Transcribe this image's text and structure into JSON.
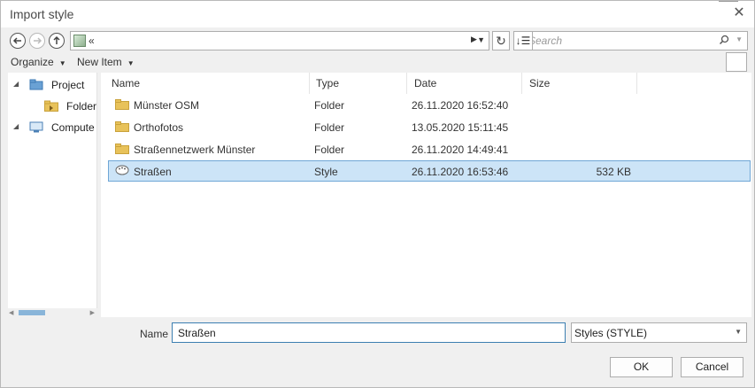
{
  "window": {
    "title": "Import style"
  },
  "nav": {
    "address_text": "«",
    "search_placeholder": "Search"
  },
  "toolbar": {
    "organize_label": "Organize",
    "new_item_label": "New Item"
  },
  "tree": {
    "items": [
      {
        "label": "Project"
      },
      {
        "label": "Folder"
      },
      {
        "label": "Compute"
      }
    ]
  },
  "list": {
    "columns": [
      "Name",
      "Type",
      "Date",
      "Size"
    ],
    "rows": [
      {
        "name": "Münster OSM",
        "type": "Folder",
        "date": "26.11.2020 16:52:40",
        "size": ""
      },
      {
        "name": "Orthofotos",
        "type": "Folder",
        "date": "13.05.2020 15:11:45",
        "size": ""
      },
      {
        "name": "Straßennetzwerk Münster",
        "type": "Folder",
        "date": "26.11.2020 14:49:41",
        "size": ""
      },
      {
        "name": "Straßen",
        "type": "Style",
        "date": "26.11.2020 16:53:46",
        "size": "532 KB"
      }
    ]
  },
  "footer": {
    "name_label": "Name",
    "name_value": "Straßen",
    "filter_value": "Styles (STYLE)",
    "ok_label": "OK",
    "cancel_label": "Cancel"
  },
  "colors": {
    "selection": "#cce4f7",
    "selection_border": "#6fa6d6",
    "folder": "#e8c25a"
  }
}
